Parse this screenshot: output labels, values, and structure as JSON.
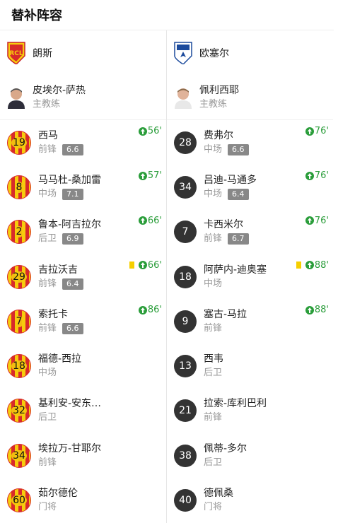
{
  "header": {
    "title": "替补阵容"
  },
  "left": {
    "team": "朗斯",
    "team_logo": "lens-crest",
    "coach": {
      "name": "皮埃尔-萨热",
      "role": "主教练"
    },
    "players": [
      {
        "number": "19",
        "name": "西马",
        "position": "前锋",
        "rating": "6.6",
        "sub_in": "56'",
        "yellow": false
      },
      {
        "number": "8",
        "name": "马马杜-桑加雷",
        "position": "中场",
        "rating": "7.1",
        "sub_in": "57'",
        "yellow": false
      },
      {
        "number": "2",
        "name": "鲁本-阿吉拉尔",
        "position": "后卫",
        "rating": "6.9",
        "sub_in": "66'",
        "yellow": false
      },
      {
        "number": "29",
        "name": "吉拉沃吉",
        "position": "前锋",
        "rating": "6.4",
        "sub_in": "66'",
        "yellow": true
      },
      {
        "number": "7",
        "name": "索托卡",
        "position": "前锋",
        "rating": "6.6",
        "sub_in": "86'",
        "yellow": false
      },
      {
        "number": "18",
        "name": "福德-西拉",
        "position": "中场",
        "rating": "",
        "sub_in": "",
        "yellow": false
      },
      {
        "number": "32",
        "name": "基利安-安东…",
        "position": "后卫",
        "rating": "",
        "sub_in": "",
        "yellow": false
      },
      {
        "number": "34",
        "name": "埃拉万-甘耶尔",
        "position": "前锋",
        "rating": "",
        "sub_in": "",
        "yellow": false
      },
      {
        "number": "60",
        "name": "茹尔德伦",
        "position": "门将",
        "rating": "",
        "sub_in": "",
        "yellow": false
      }
    ]
  },
  "right": {
    "team": "欧塞尔",
    "team_logo": "auxerre-crest",
    "coach": {
      "name": "佩利西耶",
      "role": "主教练"
    },
    "players": [
      {
        "number": "28",
        "name": "费弗尔",
        "position": "中场",
        "rating": "6.6",
        "sub_in": "76'",
        "yellow": false
      },
      {
        "number": "34",
        "name": "吕迪-马通多",
        "position": "中场",
        "rating": "6.4",
        "sub_in": "76'",
        "yellow": false
      },
      {
        "number": "7",
        "name": "卡西米尔",
        "position": "前锋",
        "rating": "6.7",
        "sub_in": "76'",
        "yellow": false
      },
      {
        "number": "18",
        "name": "阿萨内-迪奥塞",
        "position": "中场",
        "rating": "",
        "sub_in": "88'",
        "yellow": true
      },
      {
        "number": "9",
        "name": "塞古-马拉",
        "position": "前锋",
        "rating": "",
        "sub_in": "88'",
        "yellow": false
      },
      {
        "number": "13",
        "name": "西韦",
        "position": "后卫",
        "rating": "",
        "sub_in": "",
        "yellow": false
      },
      {
        "number": "21",
        "name": "拉索-库利巴利",
        "position": "前锋",
        "rating": "",
        "sub_in": "",
        "yellow": false
      },
      {
        "number": "38",
        "name": "佩蒂-多尔",
        "position": "后卫",
        "rating": "",
        "sub_in": "",
        "yellow": false
      },
      {
        "number": "40",
        "name": "德佩桑",
        "position": "门将",
        "rating": "",
        "sub_in": "",
        "yellow": false
      }
    ]
  }
}
